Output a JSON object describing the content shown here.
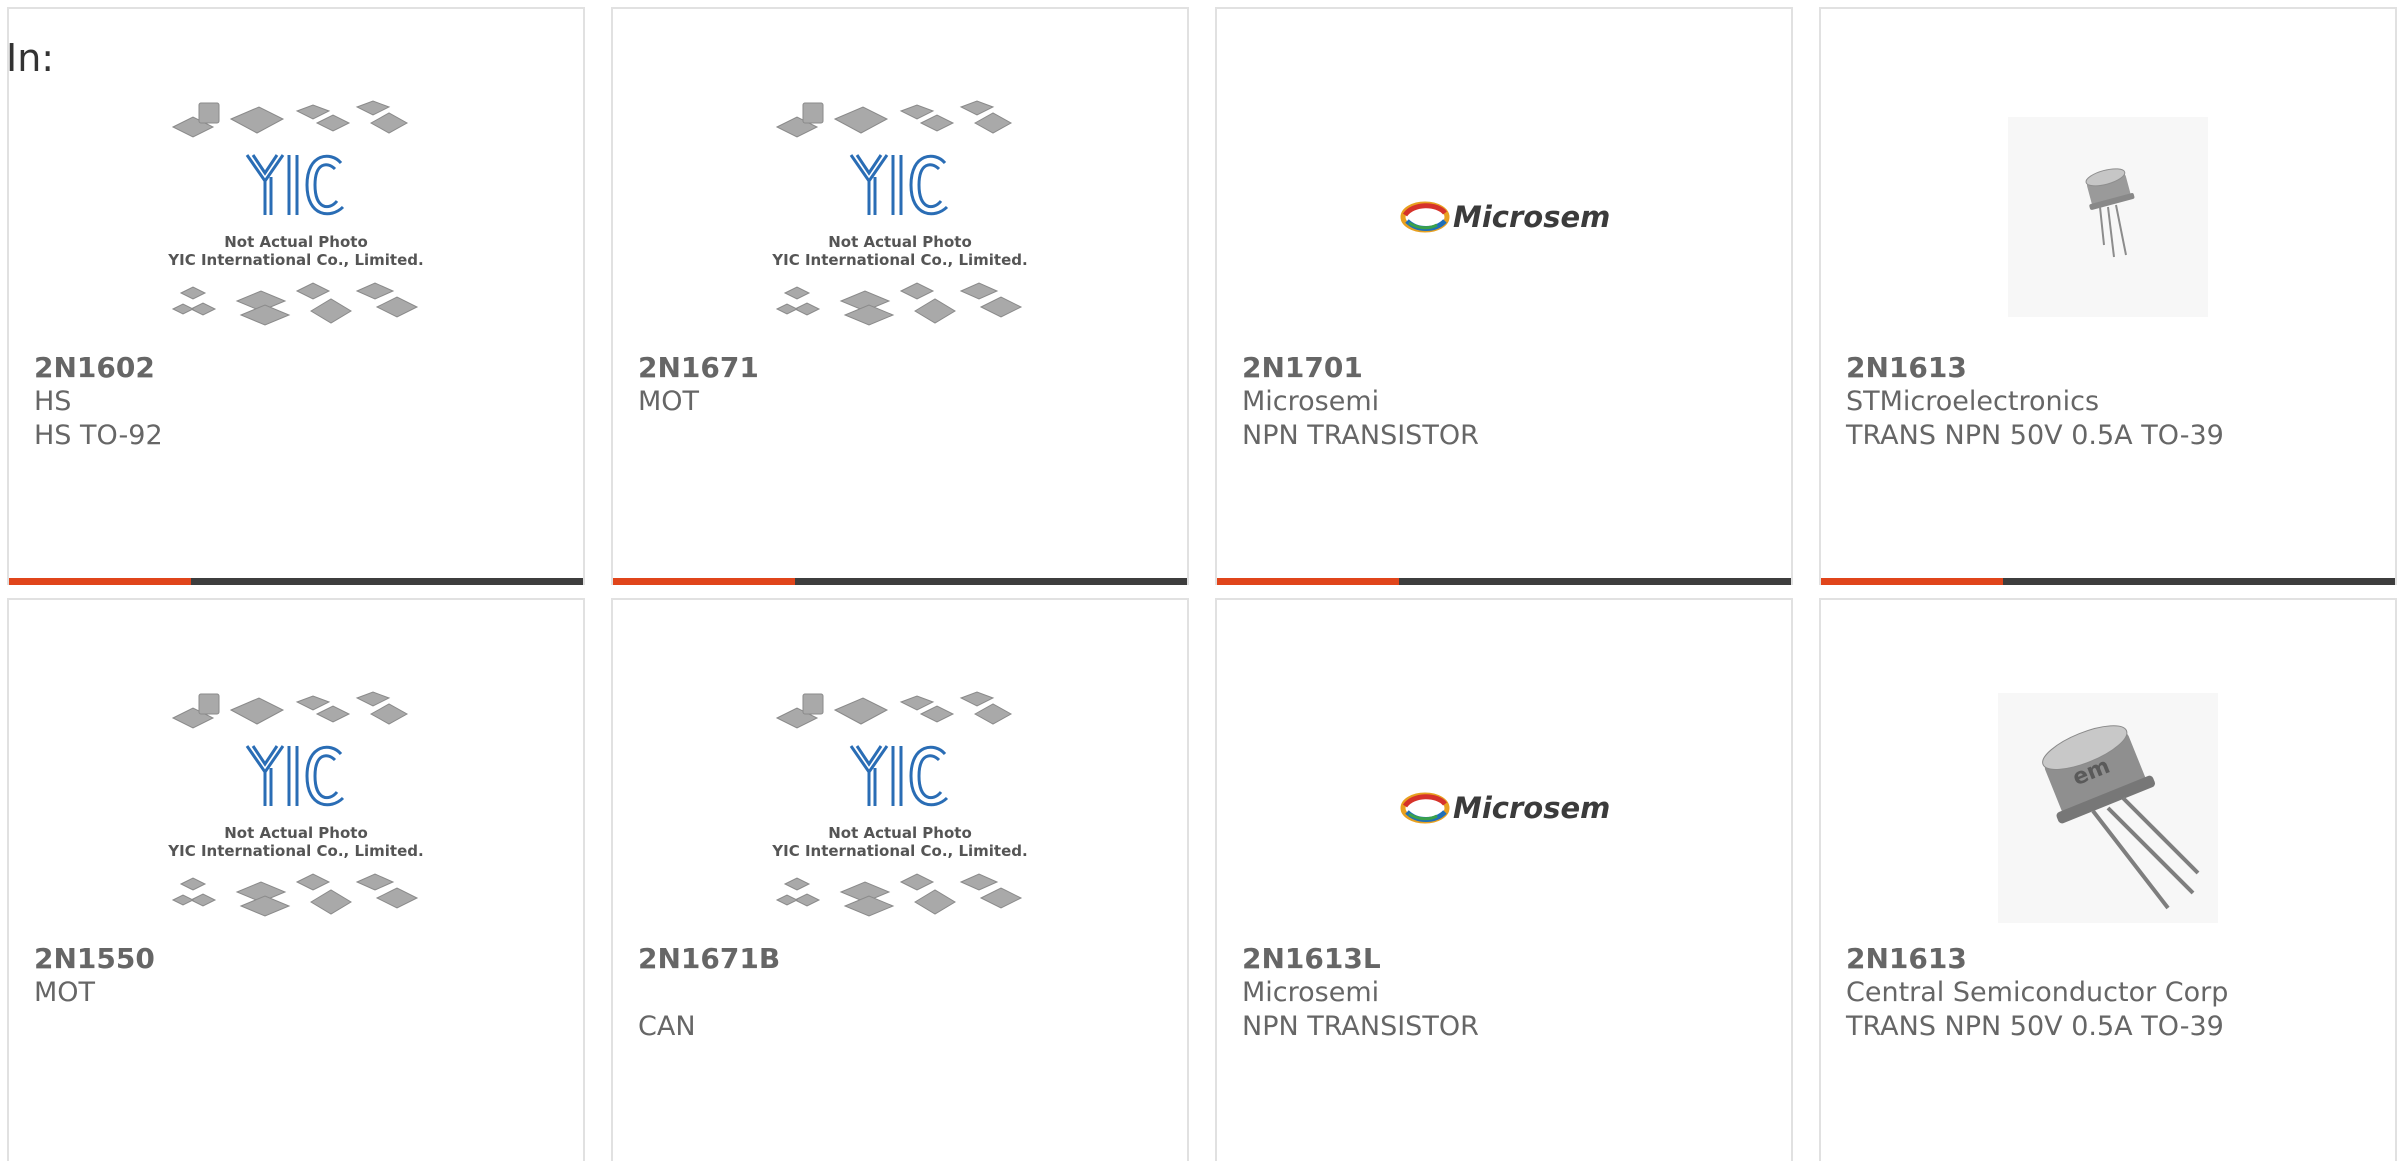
{
  "header": {
    "label": "In:"
  },
  "colors": {
    "accent": "#e0451b",
    "bar": "#3d3d3d",
    "text": "#666666",
    "border": "#e1e1e1"
  },
  "placeholder": {
    "line1": "Not Actual Photo",
    "line2": "YIC International Co., Limited.",
    "logo_text": "YIC"
  },
  "products": [
    {
      "part": "2N1602",
      "manufacturer": "HS",
      "description": "HS TO-92",
      "image": "yic-placeholder"
    },
    {
      "part": "2N1671",
      "manufacturer": "MOT",
      "description": "",
      "image": "yic-placeholder"
    },
    {
      "part": "2N1701",
      "manufacturer": "Microsemi",
      "description": "NPN TRANSISTOR",
      "image": "microsemi-logo",
      "logo_text": "Microsemi"
    },
    {
      "part": "2N1613",
      "manufacturer": "STMicroelectronics",
      "description": "TRANS NPN 50V 0.5A TO-39",
      "image": "transistor-small"
    },
    {
      "part": "2N1550",
      "manufacturer": "MOT",
      "description": "",
      "image": "yic-placeholder"
    },
    {
      "part": "2N1671B",
      "manufacturer": "",
      "description": "CAN",
      "image": "yic-placeholder"
    },
    {
      "part": "2N1613L",
      "manufacturer": "Microsemi",
      "description": "NPN TRANSISTOR",
      "image": "microsemi-logo",
      "logo_text": "Microsemi"
    },
    {
      "part": "2N1613",
      "manufacturer": "Central Semiconductor Corp",
      "description": "TRANS NPN 50V 0.5A TO-39",
      "image": "transistor-large"
    }
  ]
}
